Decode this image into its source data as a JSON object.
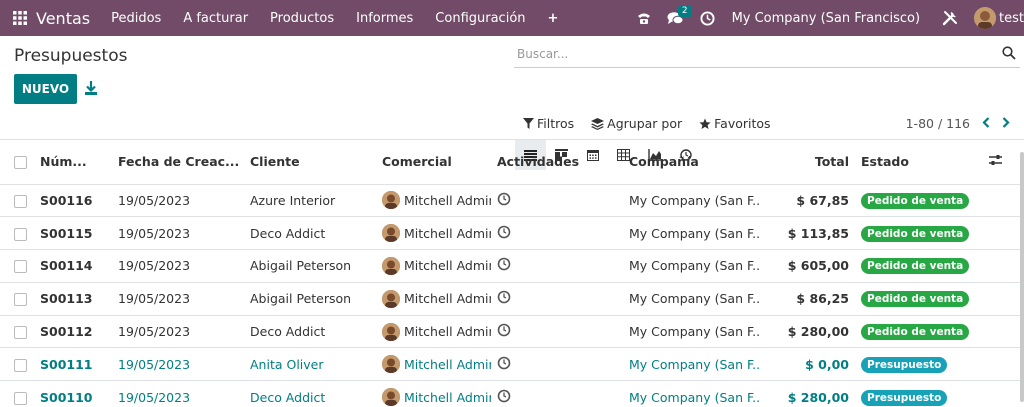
{
  "navbar": {
    "app_name": "Ventas",
    "menus": [
      "Pedidos",
      "A facturar",
      "Productos",
      "Informes",
      "Configuración"
    ],
    "plus": "+",
    "chat_count": "2",
    "company": "My Company (San Francisco)",
    "user": "test"
  },
  "page": {
    "title": "Presupuestos",
    "new_button": "NUEVO"
  },
  "search": {
    "placeholder": "Buscar..."
  },
  "filters": {
    "filters": "Filtros",
    "group_by": "Agrupar por",
    "favorites": "Favoritos"
  },
  "pager": {
    "range": "1-80 / 116"
  },
  "table": {
    "headers": {
      "number": "Núm...",
      "date": "Fecha de Creac...",
      "customer": "Cliente",
      "salesperson": "Comercial",
      "activities": "Actividades",
      "company": "Compañía",
      "total": "Total",
      "status": "Estado"
    },
    "rows": [
      {
        "number": "S00116",
        "date": "19/05/2023",
        "customer": "Azure Interior",
        "salesperson": "Mitchell Admin",
        "company": "My Company (San F...",
        "total": "$ 67,85",
        "status": "Pedido de venta"
      },
      {
        "number": "S00115",
        "date": "19/05/2023",
        "customer": "Deco Addict",
        "salesperson": "Mitchell Admin",
        "company": "My Company (San F...",
        "total": "$ 113,85",
        "status": "Pedido de venta"
      },
      {
        "number": "S00114",
        "date": "19/05/2023",
        "customer": "Abigail Peterson",
        "salesperson": "Mitchell Admin",
        "company": "My Company (San F...",
        "total": "$ 605,00",
        "status": "Pedido de venta"
      },
      {
        "number": "S00113",
        "date": "19/05/2023",
        "customer": "Abigail Peterson",
        "salesperson": "Mitchell Admin",
        "company": "My Company (San F...",
        "total": "$ 86,25",
        "status": "Pedido de venta"
      },
      {
        "number": "S00112",
        "date": "19/05/2023",
        "customer": "Deco Addict",
        "salesperson": "Mitchell Admin",
        "company": "My Company (San F...",
        "total": "$ 280,00",
        "status": "Pedido de venta"
      },
      {
        "number": "S00111",
        "date": "19/05/2023",
        "customer": "Anita Oliver",
        "salesperson": "Mitchell Admin",
        "company": "My Company (San F...",
        "total": "$ 0,00",
        "status": "Presupuesto"
      },
      {
        "number": "S00110",
        "date": "19/05/2023",
        "customer": "Deco Addict",
        "salesperson": "Mitchell Admin",
        "company": "My Company (San F...",
        "total": "$ 280,00",
        "status": "Presupuesto"
      }
    ]
  },
  "colors": {
    "navbar": "#714b67",
    "primary": "#017e84",
    "sale_order": "#28a745",
    "quotation": "#17a2b8"
  }
}
